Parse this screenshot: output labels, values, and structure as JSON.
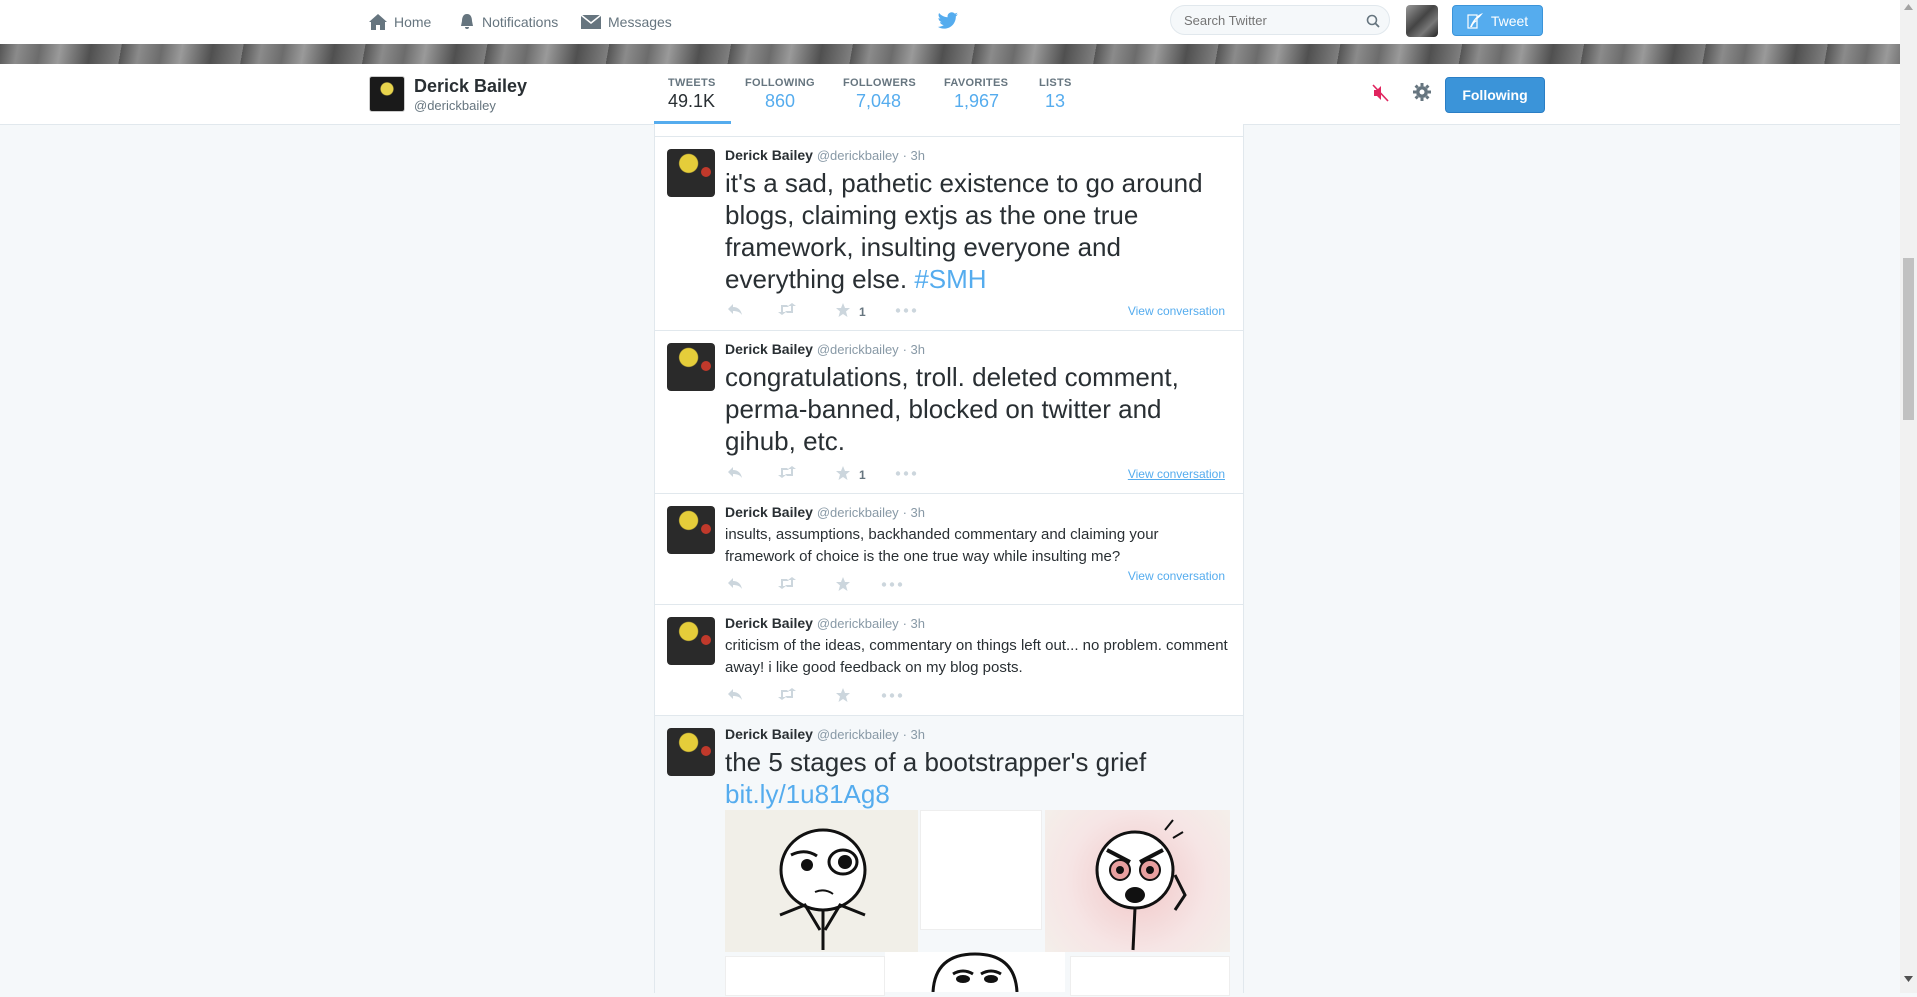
{
  "topbar": {
    "home_label": "Home",
    "notifications_label": "Notifications",
    "messages_label": "Messages",
    "search_placeholder": "Search Twitter",
    "tweet_button_label": "Tweet"
  },
  "profile": {
    "name": "Derick Bailey",
    "handle": "@derickbailey",
    "stats": [
      {
        "label": "TWEETS",
        "value": "49.1K"
      },
      {
        "label": "FOLLOWING",
        "value": "860"
      },
      {
        "label": "FOLLOWERS",
        "value": "7,048"
      },
      {
        "label": "FAVORITES",
        "value": "1,967"
      },
      {
        "label": "LISTS",
        "value": "13"
      }
    ],
    "following_button_label": "Following"
  },
  "tweets": [
    {
      "name": "Derick Bailey",
      "handle": "@derickbailey",
      "time": "· 3h",
      "text": "it's a sad, pathetic existence to go around blogs, claiming extjs as the one true framework, insulting everyone and everything else.",
      "hashtag": "#SMH",
      "fav_count": "1",
      "view_conversation": "View conversation"
    },
    {
      "name": "Derick Bailey",
      "handle": "@derickbailey",
      "time": "· 3h",
      "text": "congratulations, troll. deleted comment, perma-banned, blocked on twitter and gihub, etc.",
      "fav_count": "1",
      "view_conversation": "View conversation"
    },
    {
      "name": "Derick Bailey",
      "handle": "@derickbailey",
      "time": "· 3h",
      "text": "insults, assumptions, backhanded commentary and claiming your framework of choice is the one true way while insulting me?",
      "view_conversation": "View conversation"
    },
    {
      "name": "Derick Bailey",
      "handle": "@derickbailey",
      "time": "· 3h",
      "text": "criticism of the ideas, commentary on things left out... no problem. comment away! i like good feedback on my blog posts."
    },
    {
      "name": "Derick Bailey",
      "handle": "@derickbailey",
      "time": "· 3h",
      "text": "the 5 stages of a bootstrapper's grief",
      "link": "bit.ly/1u81Ag8"
    }
  ],
  "colors": {
    "accent": "#55acee",
    "background": "#f5f8fa",
    "mute_red": "#e0245e"
  }
}
